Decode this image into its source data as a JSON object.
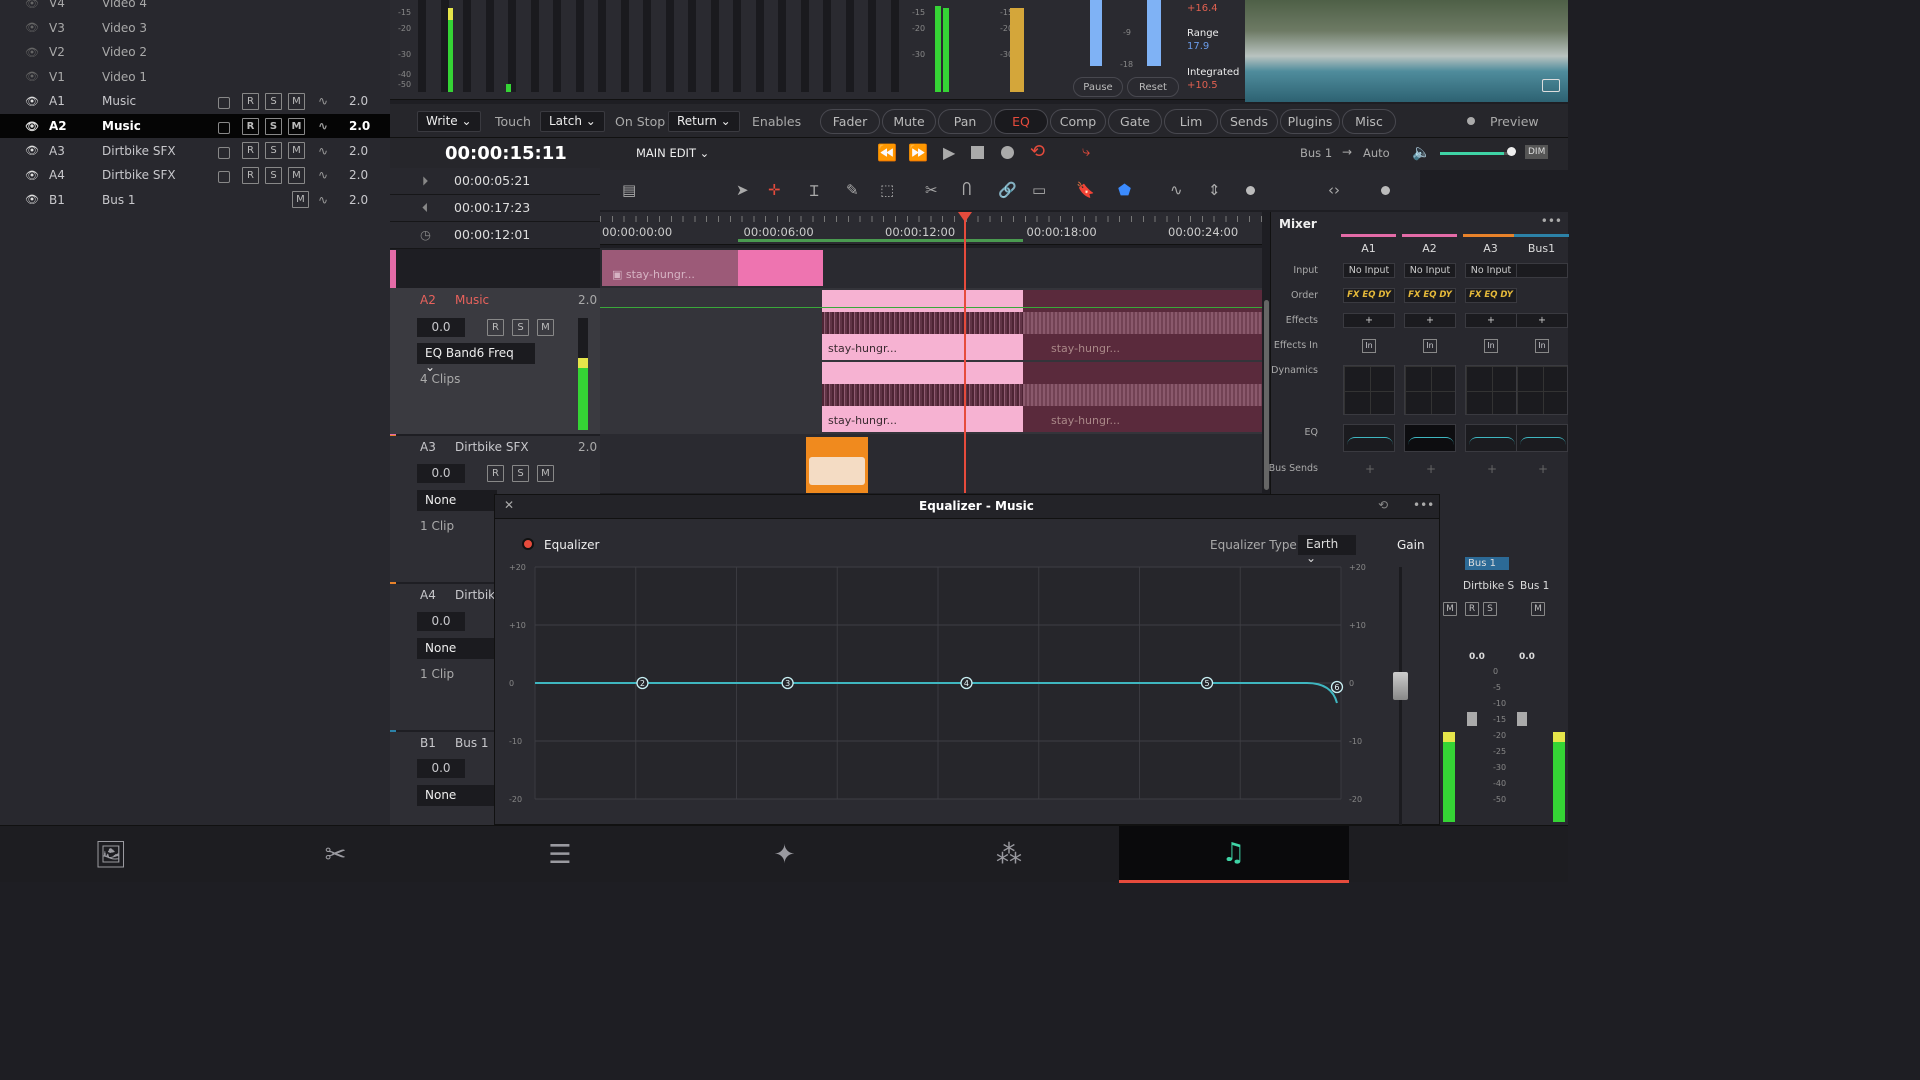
{
  "track_list": [
    {
      "id": "V4",
      "name": "Video 4",
      "type": "video",
      "visible": false
    },
    {
      "id": "V3",
      "name": "Video 3",
      "type": "video",
      "visible": false
    },
    {
      "id": "V2",
      "name": "Video 2",
      "type": "video",
      "visible": false
    },
    {
      "id": "V1",
      "name": "Video 1",
      "type": "video",
      "visible": false
    },
    {
      "id": "A1",
      "name": "Music",
      "type": "audio",
      "value": "2.0",
      "visible": true
    },
    {
      "id": "A2",
      "name": "Music",
      "type": "audio",
      "value": "2.0",
      "visible": true,
      "selected": true
    },
    {
      "id": "A3",
      "name": "Dirtbike SFX",
      "type": "audio",
      "value": "2.0",
      "visible": true
    },
    {
      "id": "A4",
      "name": "Dirtbike SFX",
      "type": "audio",
      "value": "2.0",
      "visible": true
    },
    {
      "id": "B1",
      "name": "Bus 1",
      "type": "bus",
      "value": "2.0",
      "visible": true
    }
  ],
  "buttons": {
    "r": "R",
    "s": "S",
    "m": "M"
  },
  "meters": {
    "scale": [
      "-15",
      "-20",
      "-30",
      "-40",
      "-50"
    ],
    "loudness_scale": [
      "-9",
      "-18"
    ],
    "short_term": "+16.4",
    "range_label": "Range",
    "range": "17.9",
    "integrated_label": "Integrated",
    "integrated": "+10.5",
    "pause": "Pause",
    "reset": "Reset"
  },
  "automation": {
    "write": "Write",
    "touch": "Touch",
    "latch": "Latch",
    "on_stop": "On Stop",
    "return": "Return",
    "enables": "Enables",
    "pills": [
      "Fader",
      "Mute",
      "Pan",
      "EQ",
      "Comp",
      "Gate",
      "Lim",
      "Sends",
      "Plugins",
      "Misc"
    ],
    "active_pill": "EQ",
    "preview": "Preview"
  },
  "transport": {
    "timecode": "00:00:15:11",
    "timeline": "MAIN EDIT",
    "bus": "Bus 1",
    "arrow": "→",
    "auto": "Auto",
    "dim": "DIM",
    "volume": 0.85
  },
  "tc_info": {
    "in": "00:00:05:21",
    "out": "00:00:17:23",
    "duration": "00:00:12:01"
  },
  "ruler": [
    "00:00:00:00",
    "00:00:06:00",
    "00:00:12:00",
    "00:00:18:00",
    "00:00:24:00"
  ],
  "timeline_tracks": {
    "a2": {
      "id": "A2",
      "name": "Music",
      "value": "2.0",
      "volume": "0.0",
      "automation_param": "EQ Band6 Freq",
      "clips": "4 Clips"
    },
    "a3": {
      "id": "A3",
      "name": "Dirtbike SFX",
      "value": "2.0",
      "volume": "0.0",
      "automation_param": "None",
      "clips": "1 Clip"
    },
    "a4": {
      "id": "A4",
      "name": "Dirtbike",
      "volume": "0.0",
      "automation_param": "None",
      "clips": "1 Clip"
    },
    "b1": {
      "id": "B1",
      "name": "Bus 1",
      "volume": "0.0",
      "automation_param": "None"
    },
    "clip_name": "stay-hungr..."
  },
  "mixer": {
    "title": "Mixer",
    "columns": [
      "A1",
      "A2",
      "A3",
      "Bus1"
    ],
    "rows": {
      "input": "Input",
      "order": "Order",
      "effects": "Effects",
      "effects_in": "Effects In",
      "dynamics": "Dynamics",
      "eq": "EQ",
      "bus_sends": "Bus Sends"
    },
    "input_value": "No Input",
    "order_value": "FX EQ DY",
    "plus": "+",
    "in": "In",
    "bus_tag": "Bus 1",
    "strip_names": [
      "Dirtbike S",
      "Bus 1"
    ],
    "strip_values": [
      "0.0",
      "0.0"
    ],
    "fader_scale": [
      "0",
      "-5",
      "-10",
      "-15",
      "-20",
      "-25",
      "-30",
      "-40",
      "-50"
    ]
  },
  "equalizer": {
    "title": "Equalizer - Music",
    "enabled_label": "Equalizer",
    "type_label": "Equalizer Type",
    "type_value": "Earth",
    "gain_label": "Gain",
    "y_ticks": [
      "+20",
      "+10",
      "0",
      "-10",
      "-20"
    ],
    "bands": [
      {
        "n": "2",
        "gain_db": 0,
        "pos": 0.134
      },
      {
        "n": "3",
        "gain_db": 0,
        "pos": 0.315
      },
      {
        "n": "4",
        "gain_db": 0,
        "pos": 0.538
      },
      {
        "n": "5",
        "gain_db": 0,
        "pos": 0.838
      },
      {
        "n": "6",
        "gain_db": 0,
        "pos": 1.0
      }
    ],
    "curve_color": "#3fb6c0"
  },
  "pages": [
    {
      "name": "media",
      "icon": "media-icon"
    },
    {
      "name": "cut",
      "icon": "cut-icon"
    },
    {
      "name": "edit",
      "icon": "edit-icon"
    },
    {
      "name": "color",
      "icon": "color-icon"
    },
    {
      "name": "fusion",
      "icon": "fusion-icon"
    },
    {
      "name": "fairlight",
      "icon": "fairlight-icon",
      "active": true
    }
  ],
  "colors": {
    "accent_red": "#e64b3c",
    "clip_pink": "#f4a9cc",
    "clip_dim": "#5a2a3c",
    "sfx_orange": "#f08a1e",
    "meter_green": "#35d435",
    "blue": "#3b8bff"
  }
}
